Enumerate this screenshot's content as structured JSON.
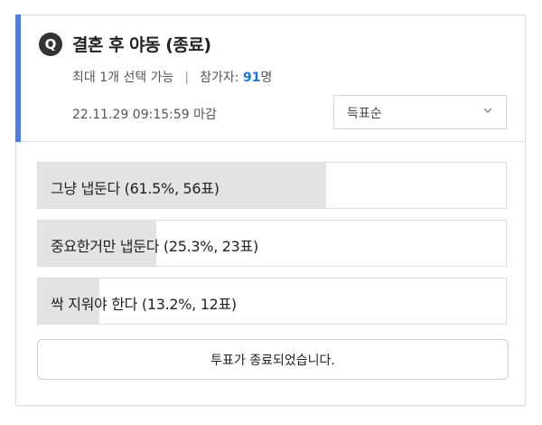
{
  "poll": {
    "badge": "Q",
    "title": "결혼 후 야동 (종료)",
    "select_limit": "최대 1개 선택 가능",
    "separator": "|",
    "participants_label": "참가자:",
    "participants_count": "91",
    "participants_unit": "명",
    "deadline": "22.11.29 09:15:59 마감",
    "sort": {
      "selected": "득표순"
    },
    "options": [
      {
        "text": "그냥 냅둔다 (61.5%, 56표)",
        "percent": 61.5
      },
      {
        "text": "중요한거만 냅둔다 (25.3%, 23표)",
        "percent": 25.3
      },
      {
        "text": "싹 지워야 한다 (13.2%, 12표)",
        "percent": 13.2
      }
    ],
    "closed_label": "투표가 종료되었습니다.",
    "colors": {
      "accent": "#4f7de3",
      "count": "#1a73e8",
      "fill": "#e3e3e3"
    }
  }
}
